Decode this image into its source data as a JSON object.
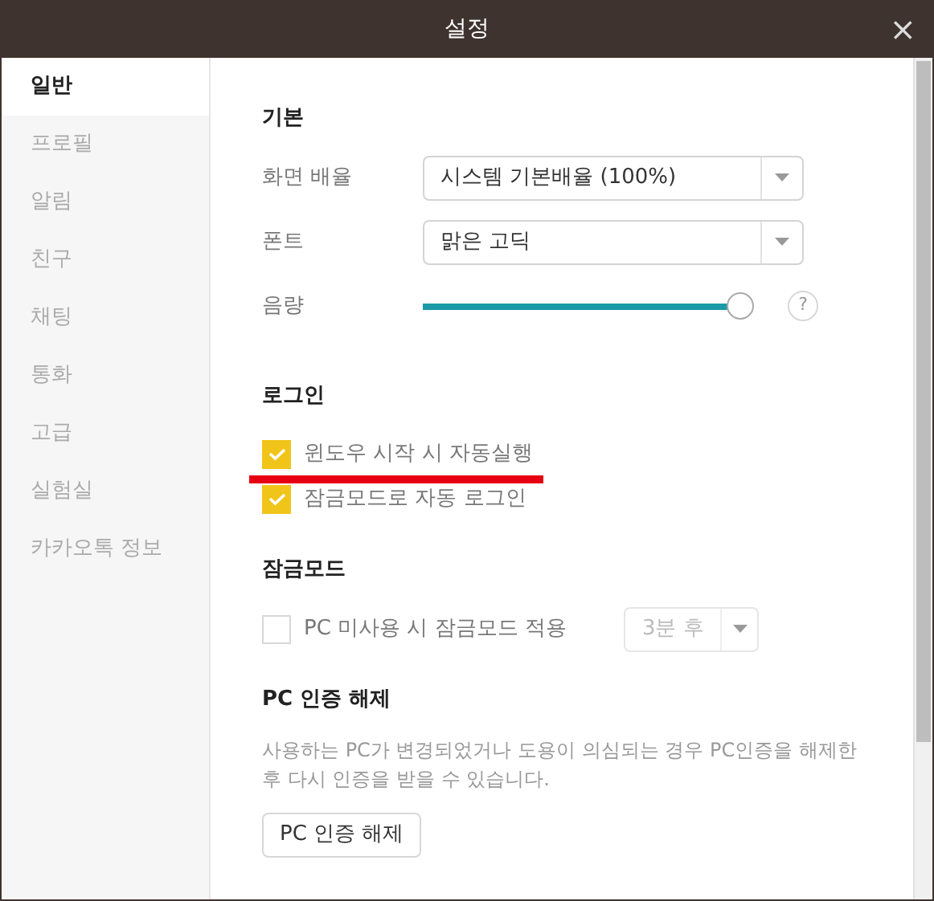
{
  "window": {
    "title": "설정",
    "close": "×"
  },
  "sidebar": {
    "items": [
      {
        "label": "일반",
        "selected": true
      },
      {
        "label": "프로필",
        "selected": false
      },
      {
        "label": "알림",
        "selected": false
      },
      {
        "label": "친구",
        "selected": false
      },
      {
        "label": "채팅",
        "selected": false
      },
      {
        "label": "통화",
        "selected": false
      },
      {
        "label": "고급",
        "selected": false
      },
      {
        "label": "실험실",
        "selected": false
      },
      {
        "label": "카카오톡 정보",
        "selected": false
      }
    ]
  },
  "sections": [
    {
      "title": "기본",
      "rows": [
        {
          "kind": "select",
          "label": "화면 배율",
          "value": "시스템 기본배율 (100%)"
        },
        {
          "kind": "select",
          "label": "폰트",
          "value": "맑은 고딕"
        },
        {
          "kind": "slider",
          "label": "음량",
          "level": 1,
          "help": "?"
        }
      ]
    },
    {
      "title": "로그인",
      "rows": [
        {
          "kind": "checkbox",
          "label": "윈도우 시작 시 자동실행",
          "checked": true,
          "underlined": true
        },
        {
          "kind": "checkbox",
          "label": "잠금모드로 자동 로그인",
          "checked": true
        }
      ]
    },
    {
      "title": "잠금모드",
      "rows": [
        {
          "kind": "checkbox",
          "label": "PC 미사용 시 잠금모드 적용",
          "checked": false,
          "select": {
            "value": "3분 후",
            "disabled": true
          }
        }
      ]
    },
    {
      "title": "PC 인증 해제",
      "rows": [
        {
          "kind": "text",
          "text": "사용하는 PC가 변경되었거나 도용이 의심되는 경우 PC인증을 해제한 후 다시 인증을 받을 수 있습니다."
        },
        {
          "kind": "button",
          "label": "PC 인증 해제"
        }
      ]
    }
  ]
}
